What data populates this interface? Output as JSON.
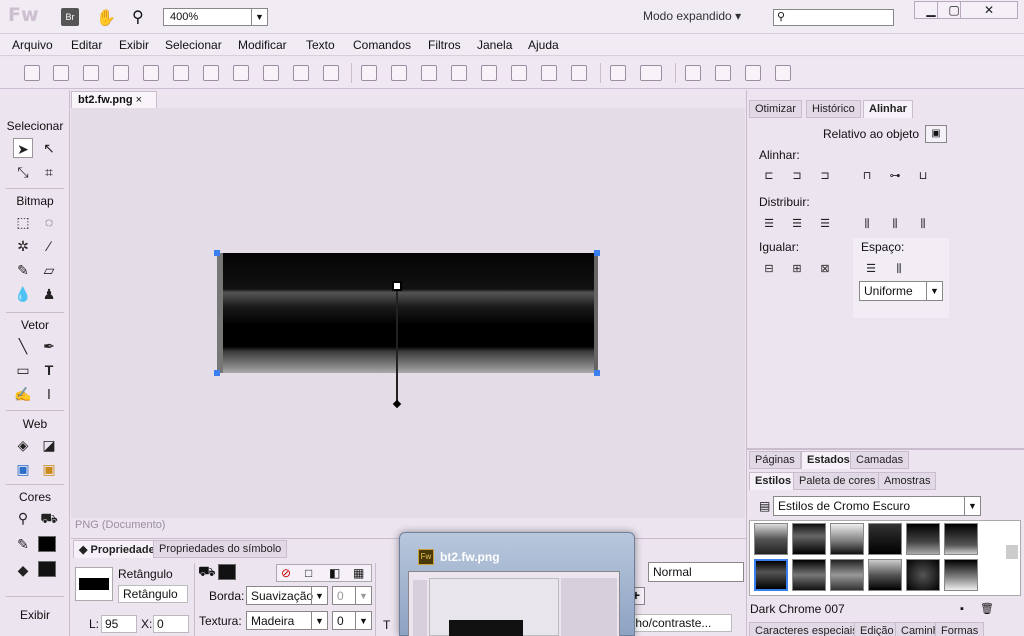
{
  "app": {
    "logo": "Fw",
    "br_icon": "Br",
    "zoom": "400%",
    "mode": "Modo expandido",
    "search_placeholder": ""
  },
  "menu": [
    "Arquivo",
    "Editar",
    "Exibir",
    "Selecionar",
    "Modificar",
    "Texto",
    "Comandos",
    "Filtros",
    "Janela",
    "Ajuda"
  ],
  "tools": {
    "sections": [
      "Selecionar",
      "Bitmap",
      "Vetor",
      "Web",
      "Cores",
      "Exibir"
    ]
  },
  "document": {
    "tab": "bt2.fw.png",
    "status": "PNG (Documento)"
  },
  "right_panel": {
    "top_tabs": [
      "Otimizar",
      "Histórico",
      "Alinhar"
    ],
    "relative": "Relativo ao objeto",
    "align_label": "Alinhar:",
    "distribute_label": "Distribuir:",
    "match_label": "Igualar:",
    "space_label": "Espaço:",
    "space_value": "Uniforme",
    "mid_tabs": [
      "Páginas",
      "Estados",
      "Camadas"
    ],
    "style_tabs": [
      "Estilos",
      "Paleta de cores",
      "Amostras"
    ],
    "style_set": "Estilos de Cromo Escuro",
    "style_name": "Dark Chrome 007",
    "bottom_tabs": [
      "Caracteres especiais",
      "Edição",
      "Caminh",
      "Formas"
    ]
  },
  "properties": {
    "tabs": [
      "Propriedades",
      "Propriedades do símbolo"
    ],
    "type": "Retângulo",
    "name": "Retângulo",
    "border_label": "Borda:",
    "border_value": "Suavização",
    "border_num": "0",
    "texture_label": "Textura:",
    "texture_value": "Madeira",
    "texture_num": "0",
    "w_label": "L:",
    "w_value": "95",
    "x_label": "X:",
    "x_value": "0",
    "blend": "Normal",
    "filter_text": "rilho/contraste...",
    "t_label": "T"
  },
  "popup": {
    "title": "bt2.fw.png",
    "icon": "Fw"
  }
}
